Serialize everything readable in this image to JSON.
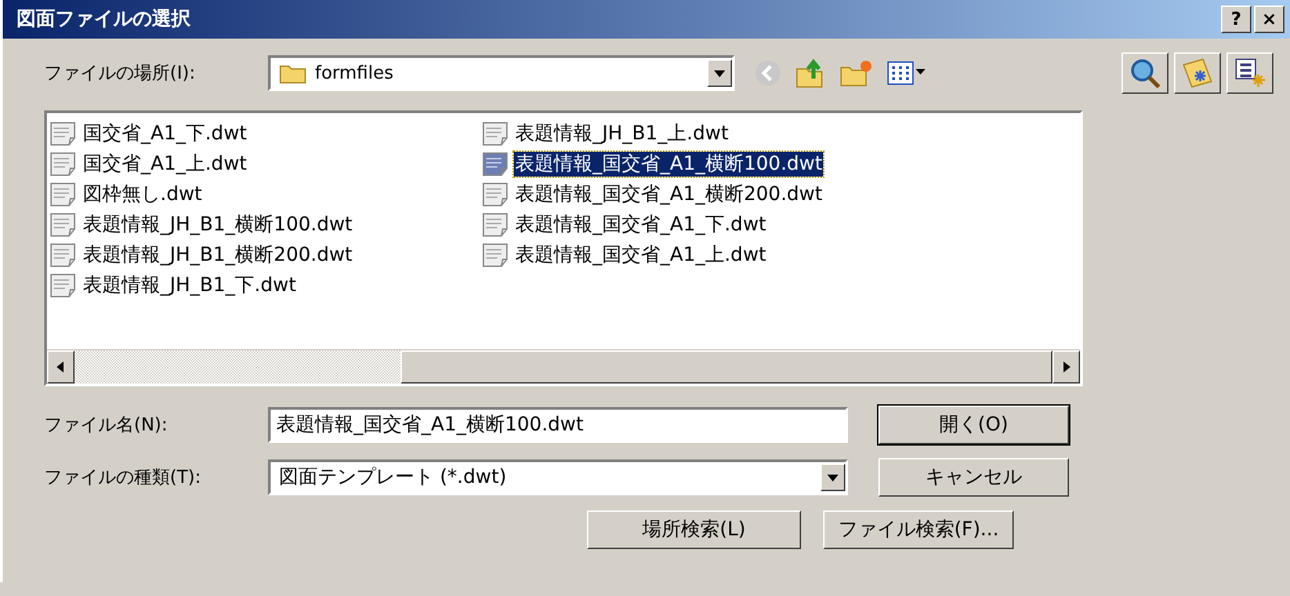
{
  "window": {
    "title": "図面ファイルの選択",
    "help_button": "?",
    "close_button": "×"
  },
  "location": {
    "label": "ファイルの場所(I):",
    "value": "formfiles"
  },
  "files": [
    {
      "name": "国交省_A1_下.dwt",
      "selected": false
    },
    {
      "name": "国交省_A1_上.dwt",
      "selected": false
    },
    {
      "name": "図枠無し.dwt",
      "selected": false
    },
    {
      "name": "表題情報_JH_B1_横断100.dwt",
      "selected": false
    },
    {
      "name": "表題情報_JH_B1_横断200.dwt",
      "selected": false
    },
    {
      "name": "表題情報_JH_B1_下.dwt",
      "selected": false
    },
    {
      "name": "表題情報_JH_B1_上.dwt",
      "selected": false
    },
    {
      "name": "表題情報_国交省_A1_横断100.dwt",
      "selected": true
    },
    {
      "name": "表題情報_国交省_A1_横断200.dwt",
      "selected": false
    },
    {
      "name": "表題情報_国交省_A1_下.dwt",
      "selected": false
    },
    {
      "name": "表題情報_国交省_A1_上.dwt",
      "selected": false
    }
  ],
  "file_name": {
    "label": "ファイル名(N):",
    "value": "表題情報_国交省_A1_横断100.dwt"
  },
  "file_type": {
    "label": "ファイルの種類(T):",
    "value": "図面テンプレート (*.dwt)"
  },
  "buttons": [
    {
      "label": "開く(O)",
      "default": true
    },
    {
      "label": "キャンセル",
      "default": false
    }
  ],
  "extra_buttons": [
    "場所検索(L)",
    "ファイル検索(F)..."
  ]
}
